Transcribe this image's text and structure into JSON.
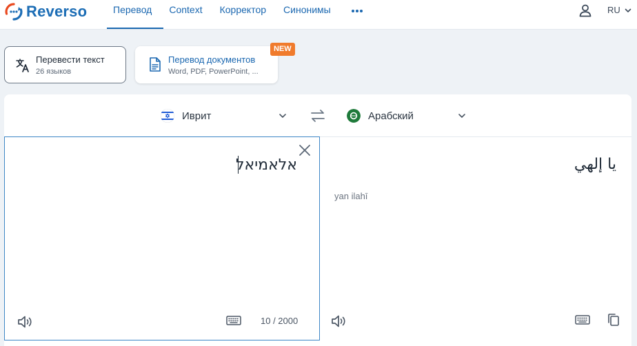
{
  "brand": {
    "name": "Reverso",
    "color": "#1c6db5",
    "accent": "#e9491f"
  },
  "nav": {
    "items": [
      {
        "label": "Перевод",
        "active": true
      },
      {
        "label": "Context",
        "active": false
      },
      {
        "label": "Корректор",
        "active": false
      },
      {
        "label": "Синонимы",
        "active": false
      }
    ],
    "more_icon": "more-dots-icon",
    "user_icon": "user-icon",
    "ui_language": "RU"
  },
  "modes": {
    "text": {
      "title": "Перевести текст",
      "subtitle": "26 языков",
      "icon": "translate-icon",
      "selected": true
    },
    "document": {
      "title": "Перевод документов",
      "subtitle": "Word, PDF, PowerPoint, ...",
      "icon": "document-icon",
      "badge": "NEW",
      "badge_color": "#f07b2c"
    }
  },
  "translator": {
    "source_language": {
      "name": "Иврит",
      "flag": "israel-flag-icon"
    },
    "target_language": {
      "name": "Арабский",
      "flag": "saudi-flag-icon"
    },
    "source_text": "אלאמיאל",
    "char_count": "10 / 2000",
    "target_text": "يا إلهي",
    "transliteration": "yan ilahī",
    "focus_color": "#3d86c6"
  }
}
